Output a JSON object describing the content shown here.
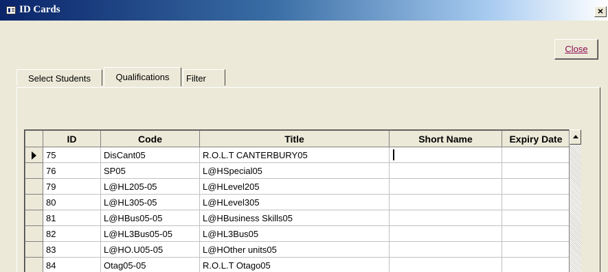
{
  "window": {
    "title": "ID Cards",
    "close_glyph": "×"
  },
  "close_button": {
    "label": "Close"
  },
  "tabs": [
    {
      "label": "Select Students"
    },
    {
      "label": "Qualifications"
    },
    {
      "label": "Filter"
    }
  ],
  "grid": {
    "columns": [
      "ID",
      "Code",
      "Title",
      "Short Name",
      "Expiry Date"
    ],
    "rows": [
      {
        "id": "75",
        "code": "DisCant05",
        "title": "R.O.L.T CANTERBURY05",
        "short_name": "",
        "expiry_date": ""
      },
      {
        "id": "76",
        "code": "SP05",
        "title": "L@HSpecial05",
        "short_name": "",
        "expiry_date": ""
      },
      {
        "id": "79",
        "code": "L@HL205-05",
        "title": "L@HLevel205",
        "short_name": "",
        "expiry_date": ""
      },
      {
        "id": "80",
        "code": "L@HL305-05",
        "title": "L@HLevel305",
        "short_name": "",
        "expiry_date": ""
      },
      {
        "id": "81",
        "code": "L@HBus05-05",
        "title": "L@HBusiness Skills05",
        "short_name": "",
        "expiry_date": ""
      },
      {
        "id": "82",
        "code": "L@HL3Bus05-05",
        "title": "L@HL3Bus05",
        "short_name": "",
        "expiry_date": ""
      },
      {
        "id": "83",
        "code": "L@HO.U05-05",
        "title": "L@HOther units05",
        "short_name": "",
        "expiry_date": ""
      },
      {
        "id": "84",
        "code": "Otag05-05",
        "title": "R.O.L.T Otago05",
        "short_name": "",
        "expiry_date": ""
      }
    ]
  },
  "icons": {
    "app": "form-icon",
    "selector": "record-selector-arrow-icon",
    "scroll": "scroll-up-arrow-icon"
  },
  "colors": {
    "title_bar": "#0a246a",
    "window_bg": "#ece9d8",
    "close_label": "#8b0a50"
  }
}
